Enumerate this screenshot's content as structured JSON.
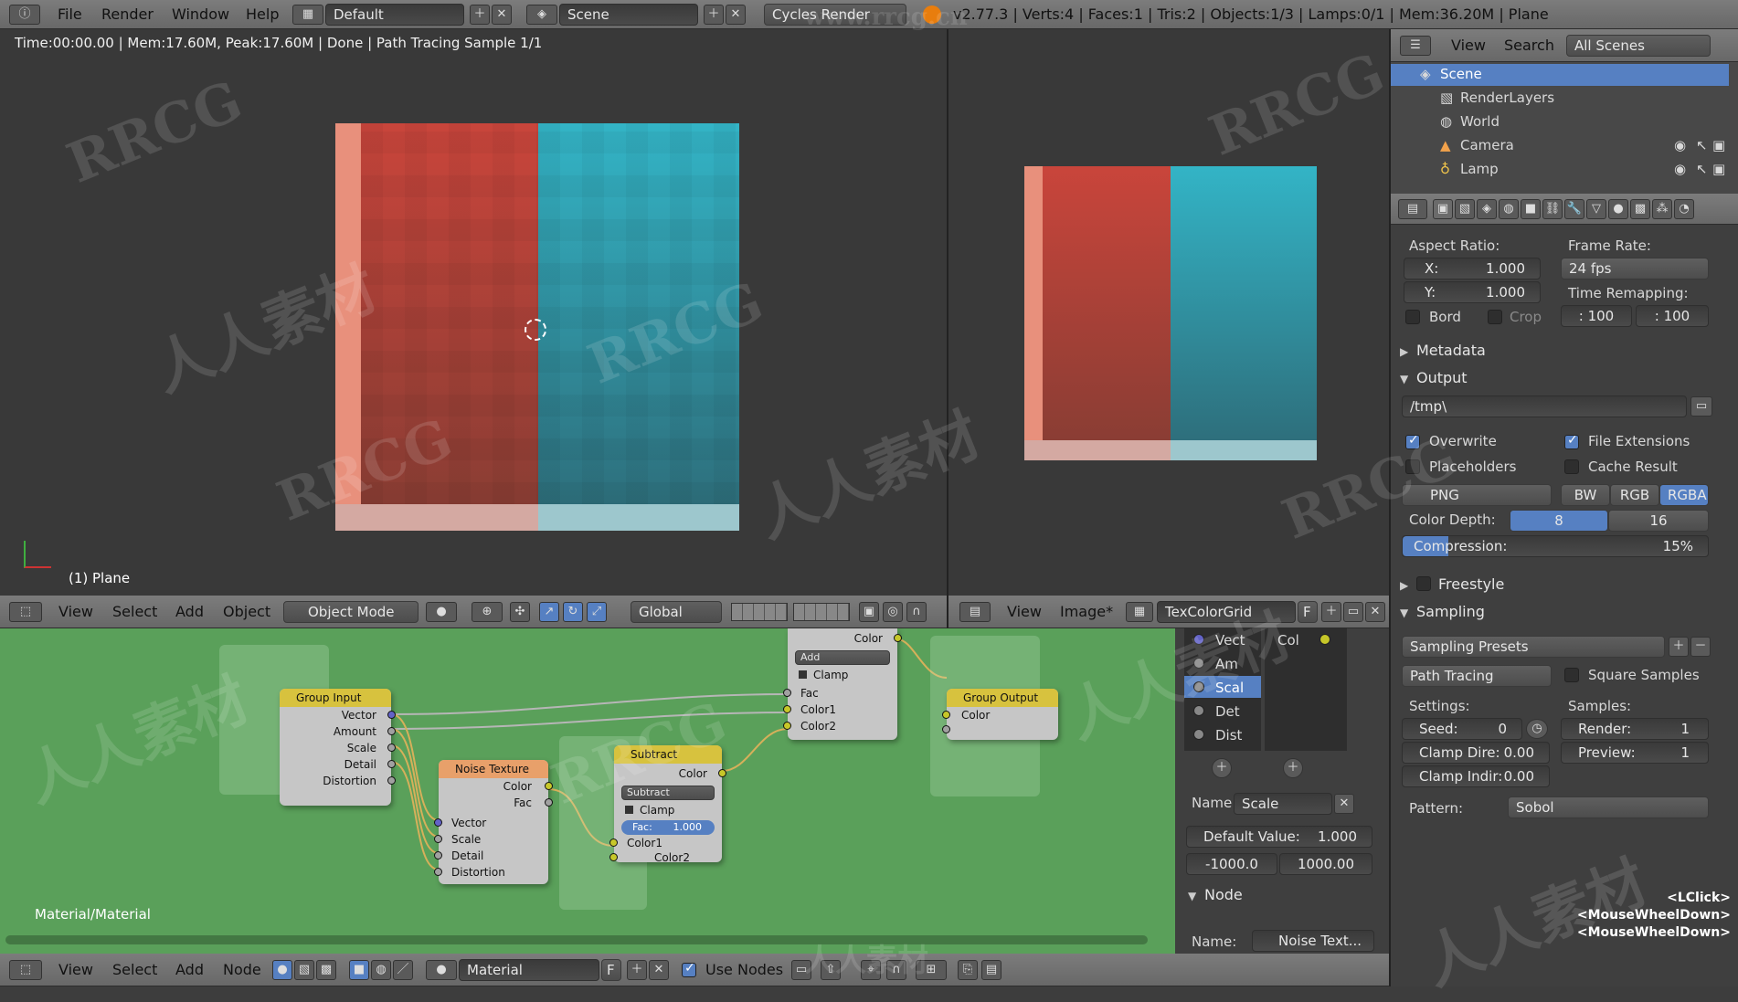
{
  "topbar": {
    "menus": [
      "File",
      "Render",
      "Window",
      "Help"
    ],
    "layout": "Default",
    "scene": "Scene",
    "engine": "Cycles Render",
    "stats": "v2.77.3 | Verts:4 | Faces:1 | Tris:2 | Objects:1/3 | Lamps:0/1 | Mem:36.20M | Plane"
  },
  "viewport": {
    "status": "Time:00:00.00 | Mem:17.60M, Peak:17.60M | Done | Path Tracing Sample 1/1",
    "object_label": "(1) Plane",
    "header": {
      "menus": [
        "View",
        "Select",
        "Add",
        "Object"
      ],
      "mode": "Object Mode",
      "orientation": "Global"
    }
  },
  "image_editor": {
    "header": {
      "menus": [
        "View",
        "Image*"
      ],
      "image_name": "TexColorGrid",
      "fake_user": "F"
    }
  },
  "outliner": {
    "header": {
      "menus": [
        "View",
        "Search"
      ],
      "filter": "All Scenes"
    },
    "items": [
      {
        "label": "Scene",
        "icon": "scene-icon",
        "selected": true
      },
      {
        "label": "RenderLayers",
        "icon": "render-layers-icon"
      },
      {
        "label": "World",
        "icon": "world-icon"
      },
      {
        "label": "Camera",
        "icon": "camera-icon"
      },
      {
        "label": "Lamp",
        "icon": "lamp-icon"
      }
    ]
  },
  "properties": {
    "aspect_ratio_label": "Aspect Ratio:",
    "aspect_x_label": "X:",
    "aspect_x": "1.000",
    "aspect_y_label": "Y:",
    "aspect_y": "1.000",
    "bord": "Bord",
    "crop": "Crop",
    "frame_rate_label": "Frame Rate:",
    "frame_rate": "24 fps",
    "time_remap_label": "Time Remapping:",
    "time_remap_old": ": 100",
    "time_remap_new": ": 100",
    "metadata": "Metadata",
    "output": "Output",
    "output_path": "/tmp\\",
    "overwrite": "Overwrite",
    "file_extensions": "File Extensions",
    "placeholders": "Placeholders",
    "cache_result": "Cache Result",
    "file_format": "PNG",
    "color_modes": [
      "BW",
      "RGB",
      "RGBA"
    ],
    "color_depth_label": "Color Depth:",
    "color_depths": [
      "8",
      "16"
    ],
    "compression_label": "Compression:",
    "compression_value": "15%",
    "compression_fraction": 0.15,
    "freestyle": "Freestyle",
    "sampling": "Sampling",
    "sampling_presets": "Sampling Presets",
    "integrator": "Path Tracing",
    "square_samples": "Square Samples",
    "settings_label": "Settings:",
    "samples_label": "Samples:",
    "seed_label": "Seed:",
    "seed": "0",
    "render_label": "Render:",
    "render_samples": "1",
    "clamp_direct_label": "Clamp Dire:",
    "clamp_direct": "0.00",
    "preview_label": "Preview:",
    "preview_samples": "1",
    "clamp_indirect_label": "Clamp Indir:",
    "clamp_indirect": "0.00",
    "pattern_label": "Pattern:",
    "pattern": "Sobol"
  },
  "node_editor": {
    "label": "Material/Material",
    "header": {
      "menus": [
        "View",
        "Select",
        "Add",
        "Node"
      ],
      "material": "Material",
      "fake_user": "F",
      "use_nodes": "Use Nodes"
    },
    "nodes": {
      "group_input": {
        "title": "Group Input",
        "outputs": [
          "Vector",
          "Amount",
          "Scale",
          "Detail",
          "Distortion"
        ]
      },
      "noise": {
        "title": "Noise Texture",
        "outputs": [
          "Color",
          "Fac"
        ],
        "inputs": [
          "Vector",
          "Scale",
          "Detail",
          "Distortion"
        ]
      },
      "subtract": {
        "title": "Subtract",
        "output": "Color",
        "op": "Subtract",
        "clamp": "Clamp",
        "fac_label": "Fac:",
        "fac_value": "1.000",
        "inputs": [
          "Color1",
          "Color2"
        ]
      },
      "add": {
        "output": "Color",
        "op": "Add",
        "clamp": "Clamp",
        "inputs": [
          "Fac",
          "Color1",
          "Color2"
        ]
      },
      "group_output": {
        "title": "Group Output",
        "input": "Color"
      }
    }
  },
  "node_sidebar": {
    "inputs": [
      "Vect",
      "Am",
      "Scal",
      "Det",
      "Dist"
    ],
    "outputs": [
      "Col"
    ],
    "name_label": "Name",
    "name_value": "Scale",
    "default_label": "Default Value:",
    "default_value": "1.000",
    "min_value": "-1000.0",
    "max_value": "1000.00",
    "node_section": "Node",
    "node_name_label": "Name:",
    "node_name_value": "Noise Text..."
  },
  "key_overlay": [
    "<LClick>",
    "<MouseWheelDown>",
    "<MouseWheelDown>"
  ],
  "watermarks": [
    "RRCG",
    "人人素材",
    "www.rrcg.cn"
  ],
  "colors": {
    "node_bg": "#5aa05a",
    "selected": "#5680c2",
    "viewport_bg": "#393939"
  }
}
